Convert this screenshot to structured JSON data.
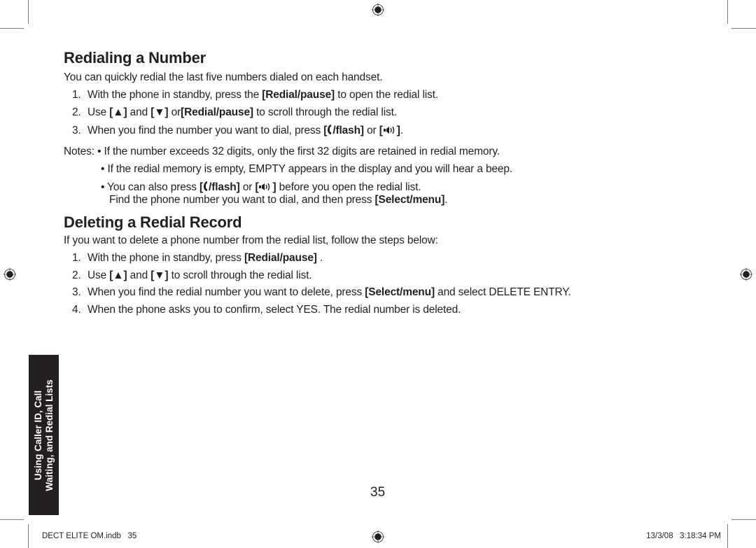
{
  "section1": {
    "title": "Redialing a Number",
    "intro": "You can quickly redial the last five numbers dialed on each handset.",
    "steps": [
      {
        "num": "1.",
        "pre": "With the phone in standby, press the ",
        "key": "[Redial/pause]",
        "post": " to open the redial list."
      },
      {
        "num": "2.",
        "pre": "Use ",
        "key_up": "[▲]",
        "mid": " and ",
        "key_down": "[▼]",
        "mid2": " or",
        "key": "[Redial/pause]",
        "post": " to scroll through the redial list."
      },
      {
        "num": "3.",
        "pre": "When you find the number you want to dial, press ",
        "key_flash": "[/flash]",
        "mid": " or ",
        "key_speaker": "[]",
        "post": "."
      }
    ],
    "notes_label": "Notes:",
    "notes": [
      "If the number exceeds 32 digits, only the first 32 digits are retained in redial memory.",
      "If the redial memory is empty, EMPTY appears in the display and you will hear a beep."
    ],
    "note3": {
      "pre": "You can also press ",
      "key_flash": "[/flash]",
      "mid": " or ",
      "key_speaker": "[]",
      "post": " before you open the redial list.",
      "line2_pre": "Find the phone number you want to dial, and then press ",
      "line2_key": "[Select/menu]",
      "line2_post": "."
    },
    "bullet": "•"
  },
  "section2": {
    "title": "Deleting a Redial Record",
    "intro": "If you want to delete a phone number from the redial list, follow the steps below:",
    "steps": [
      {
        "num": "1.",
        "pre": "With the phone in standby, press ",
        "key": "[Redial/pause]",
        "post": " ."
      },
      {
        "num": "2.",
        "pre": "Use ",
        "key_up": "[▲]",
        "mid": " and ",
        "key_down": "[▼]",
        "post": " to scroll through the redial list."
      },
      {
        "num": "3.",
        "pre": "When you find the redial number you want to delete, press ",
        "key": "[Select/menu]",
        "post": " and select DELETE ENTRY."
      },
      {
        "num": "4.",
        "pre": "When the phone asks you to confirm, select YES. The redial number is deleted."
      }
    ]
  },
  "side_tab": {
    "line1": "Using Caller ID, Call",
    "line2": "Waiting, and Redial Lists"
  },
  "page_number": "35",
  "footer": {
    "file": "DECT ELITE OM.indb   35",
    "timestamp": "13/3/08   3:18:34 PM"
  },
  "icons": {
    "registration_mark": "registration-mark-icon",
    "up_arrow": "up-arrow-icon",
    "down_arrow": "down-arrow-icon",
    "talk_flash": "talk-handset-icon",
    "speaker": "speakerphone-icon"
  }
}
